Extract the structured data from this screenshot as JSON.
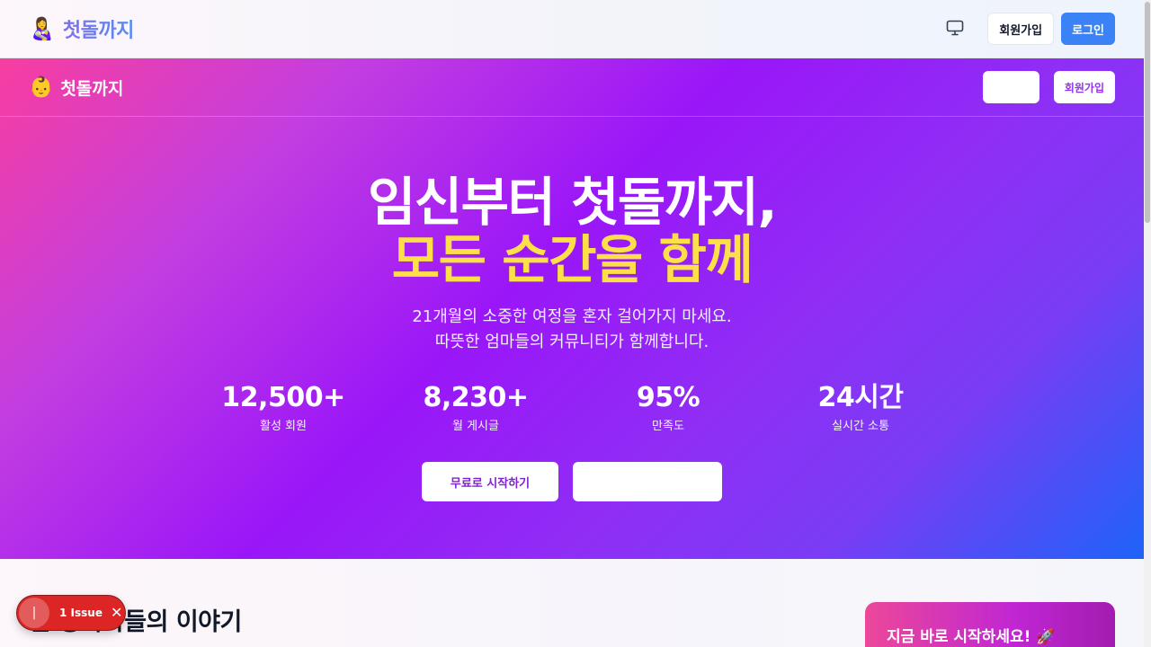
{
  "header": {
    "logo_emoji": "👩‍🍼",
    "title": "첫돌까지",
    "signup_label": "회원가입",
    "login_label": "로그인",
    "theme_icon": "monitor-icon"
  },
  "hero": {
    "nav": {
      "logo_emoji": "👶",
      "title": "첫돌까지",
      "blank_button_label": "",
      "signup_label": "회원가입"
    },
    "title_line1": "임신부터 첫돌까지,",
    "title_line2": "모든 순간을 함께",
    "subtitle_line1": "21개월의 소중한 여정을 혼자 걸어가지 마세요.",
    "subtitle_line2": "따뜻한 엄마들의 커뮤니티가 함께합니다.",
    "stats": [
      {
        "value": "12,500+",
        "label": "활성 회원"
      },
      {
        "value": "8,230+",
        "label": "월 게시글"
      },
      {
        "value": "95%",
        "label": "만족도"
      },
      {
        "value": "24시간",
        "label": "실시간 소통"
      }
    ],
    "cta_start_label": "무료로 시작하기",
    "cta_secondary_label": ""
  },
  "stories": {
    "title": "한 양육자들의 이야기"
  },
  "start_card": {
    "title": "지금 바로 시작하세요! 🚀"
  },
  "issue_badge": {
    "logo_char": "|",
    "text": "1 Issue",
    "close_glyph": "✕"
  },
  "colors": {
    "accent_blue": "#3b82f6",
    "title_yellow": "#fde047",
    "issue_red": "#dc2626",
    "signup_purple": "#9333ea"
  }
}
